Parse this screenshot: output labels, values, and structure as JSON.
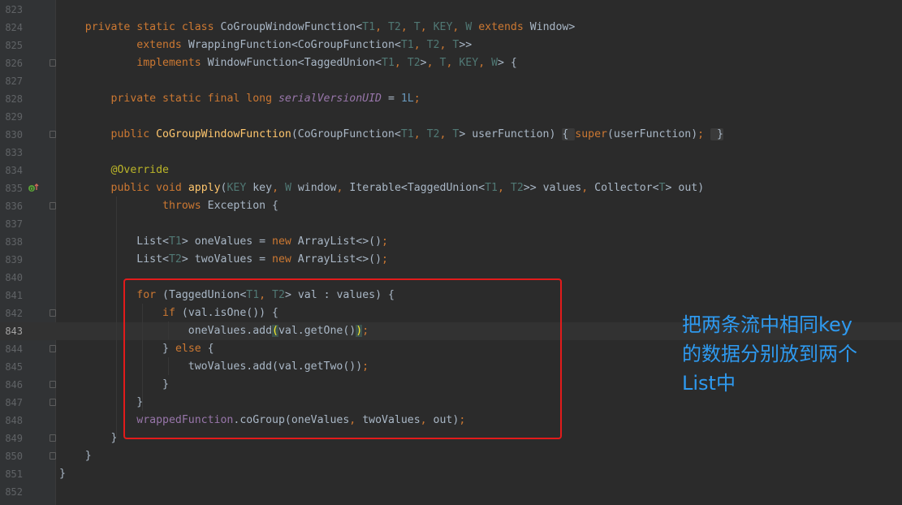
{
  "editor": {
    "lines": [
      {
        "n": "823",
        "parts": []
      },
      {
        "n": "824",
        "parts": [
          [
            "    ",
            "pl"
          ],
          [
            "private static class ",
            "kw"
          ],
          [
            "CoGroupWindowFunction<",
            "pl"
          ],
          [
            "T1",
            "tp"
          ],
          [
            ", ",
            "kw"
          ],
          [
            "T2",
            "tp"
          ],
          [
            ", ",
            "kw"
          ],
          [
            "T",
            "tp"
          ],
          [
            ", ",
            "kw"
          ],
          [
            "KEY",
            "tp"
          ],
          [
            ", ",
            "kw"
          ],
          [
            "W ",
            "tp"
          ],
          [
            "extends ",
            "kw"
          ],
          [
            "Window>",
            "pl"
          ]
        ]
      },
      {
        "n": "825",
        "parts": [
          [
            "            ",
            "pl"
          ],
          [
            "extends ",
            "kw"
          ],
          [
            "WrappingFunction<CoGroupFunction<",
            "pl"
          ],
          [
            "T1",
            "tp"
          ],
          [
            ", ",
            "kw"
          ],
          [
            "T2",
            "tp"
          ],
          [
            ", ",
            "kw"
          ],
          [
            "T",
            "tp"
          ],
          [
            ">>",
            "pl"
          ]
        ]
      },
      {
        "n": "826",
        "parts": [
          [
            "            ",
            "pl"
          ],
          [
            "implements ",
            "kw"
          ],
          [
            "WindowFunction<TaggedUnion<",
            "pl"
          ],
          [
            "T1",
            "tp"
          ],
          [
            ", ",
            "kw"
          ],
          [
            "T2",
            "tp"
          ],
          [
            ">",
            "pl"
          ],
          [
            ", ",
            "kw"
          ],
          [
            "T",
            "tp"
          ],
          [
            ", ",
            "kw"
          ],
          [
            "KEY",
            "tp"
          ],
          [
            ", ",
            "kw"
          ],
          [
            "W",
            "tp"
          ],
          [
            "> {",
            "pl"
          ]
        ]
      },
      {
        "n": "827",
        "parts": []
      },
      {
        "n": "828",
        "parts": [
          [
            "        ",
            "pl"
          ],
          [
            "private static final long ",
            "kw"
          ],
          [
            "serialVersionUID",
            "fld"
          ],
          [
            " = ",
            "pl"
          ],
          [
            "1L",
            "num"
          ],
          [
            ";",
            "kw"
          ]
        ]
      },
      {
        "n": "829",
        "parts": []
      },
      {
        "n": "830",
        "parts": [
          [
            "        ",
            "pl"
          ],
          [
            "public ",
            "kw"
          ],
          [
            "CoGroupWindowFunction",
            "fn"
          ],
          [
            "(CoGroupFunction<",
            "pl"
          ],
          [
            "T1",
            "tp"
          ],
          [
            ", ",
            "kw"
          ],
          [
            "T2",
            "tp"
          ],
          [
            ", ",
            "kw"
          ],
          [
            "T",
            "tp"
          ],
          [
            "> userFunction) ",
            "pl"
          ],
          [
            "{ ",
            "fold-hl"
          ],
          [
            "super",
            "kw"
          ],
          [
            "(userFunction)",
            "pl"
          ],
          [
            ";",
            "kw"
          ],
          [
            " ",
            "pl"
          ],
          [
            " }",
            "fold-hl"
          ]
        ]
      },
      {
        "n": "833",
        "parts": []
      },
      {
        "n": "834",
        "parts": [
          [
            "        ",
            "pl"
          ],
          [
            "@Override",
            "an"
          ]
        ]
      },
      {
        "n": "835",
        "parts": [
          [
            "        ",
            "pl"
          ],
          [
            "public void ",
            "kw"
          ],
          [
            "apply",
            "fn"
          ],
          [
            "(",
            "pl"
          ],
          [
            "KEY ",
            "tp"
          ],
          [
            "key",
            "pl"
          ],
          [
            ", ",
            "kw"
          ],
          [
            "W ",
            "tp"
          ],
          [
            "window",
            "pl"
          ],
          [
            ", ",
            "kw"
          ],
          [
            "Iterable<TaggedUnion<",
            "pl"
          ],
          [
            "T1",
            "tp"
          ],
          [
            ", ",
            "kw"
          ],
          [
            "T2",
            "tp"
          ],
          [
            ">> values",
            "pl"
          ],
          [
            ", ",
            "kw"
          ],
          [
            "Collector<",
            "pl"
          ],
          [
            "T",
            "tp"
          ],
          [
            "> out)",
            "pl"
          ]
        ]
      },
      {
        "n": "836",
        "parts": [
          [
            "                ",
            "pl"
          ],
          [
            "throws ",
            "kw"
          ],
          [
            "Exception {",
            "pl"
          ]
        ]
      },
      {
        "n": "837",
        "parts": []
      },
      {
        "n": "838",
        "parts": [
          [
            "            ",
            "pl"
          ],
          [
            "List<",
            "pl"
          ],
          [
            "T1",
            "tp"
          ],
          [
            "> oneValues = ",
            "pl"
          ],
          [
            "new ",
            "kw"
          ],
          [
            "ArrayList<>()",
            "pl"
          ],
          [
            ";",
            "kw"
          ]
        ]
      },
      {
        "n": "839",
        "parts": [
          [
            "            ",
            "pl"
          ],
          [
            "List<",
            "pl"
          ],
          [
            "T2",
            "tp"
          ],
          [
            "> twoValues = ",
            "pl"
          ],
          [
            "new ",
            "kw"
          ],
          [
            "ArrayList<>()",
            "pl"
          ],
          [
            ";",
            "kw"
          ]
        ]
      },
      {
        "n": "840",
        "parts": []
      },
      {
        "n": "841",
        "parts": [
          [
            "            ",
            "pl"
          ],
          [
            "for ",
            "kw"
          ],
          [
            "(TaggedUnion<",
            "pl"
          ],
          [
            "T1",
            "tp"
          ],
          [
            ", ",
            "kw"
          ],
          [
            "T2",
            "tp"
          ],
          [
            "> val : values) {",
            "pl"
          ]
        ]
      },
      {
        "n": "842",
        "parts": [
          [
            "                ",
            "pl"
          ],
          [
            "if ",
            "kw"
          ],
          [
            "(val.isOne()) {",
            "pl"
          ]
        ]
      },
      {
        "n": "843",
        "parts": [
          [
            "                    ",
            "pl"
          ],
          [
            "oneValues.add",
            "pl"
          ],
          [
            "(",
            "brace-hl"
          ],
          [
            "val.getOne()",
            "pl"
          ],
          [
            ")",
            "brace-hl"
          ],
          [
            ";",
            "kw"
          ]
        ]
      },
      {
        "n": "844",
        "parts": [
          [
            "                ",
            "pl"
          ],
          [
            "} ",
            "pl"
          ],
          [
            "else ",
            "kw"
          ],
          [
            "{",
            "pl"
          ]
        ]
      },
      {
        "n": "845",
        "parts": [
          [
            "                    ",
            "pl"
          ],
          [
            "twoValues.add(val.getTwo())",
            "pl"
          ],
          [
            ";",
            "kw"
          ]
        ]
      },
      {
        "n": "846",
        "parts": [
          [
            "                ",
            "pl"
          ],
          [
            "}",
            "pl"
          ]
        ]
      },
      {
        "n": "847",
        "parts": [
          [
            "            ",
            "pl"
          ],
          [
            "}",
            "pl"
          ]
        ]
      },
      {
        "n": "848",
        "parts": [
          [
            "            ",
            "pl"
          ],
          [
            "wrappedFunction",
            "ifld"
          ],
          [
            ".coGroup(oneValues",
            "pl"
          ],
          [
            ", ",
            "kw"
          ],
          [
            "twoValues",
            "pl"
          ],
          [
            ", ",
            "kw"
          ],
          [
            "out)",
            "pl"
          ],
          [
            ";",
            "kw"
          ]
        ]
      },
      {
        "n": "849",
        "parts": [
          [
            "        ",
            "pl"
          ],
          [
            "}",
            "pl"
          ]
        ]
      },
      {
        "n": "850",
        "parts": [
          [
            "    ",
            "pl"
          ],
          [
            "}",
            "pl"
          ]
        ]
      },
      {
        "n": "851",
        "parts": [
          [
            "}",
            "pl"
          ]
        ]
      },
      {
        "n": "852",
        "parts": []
      }
    ],
    "current_line": "843",
    "fold_lines": [
      "826",
      "830",
      "836",
      "842",
      "844",
      "846",
      "847",
      "849",
      "850"
    ],
    "marker_line": "835"
  },
  "annotation": {
    "text": "把两条流中相同key\n的数据分别放到两个\nList中",
    "color": "#2e9af0",
    "box_color": "#e21b1b"
  },
  "icons": {
    "override_marker": "override-implements-icon",
    "fold_marker": "fold-icon"
  }
}
